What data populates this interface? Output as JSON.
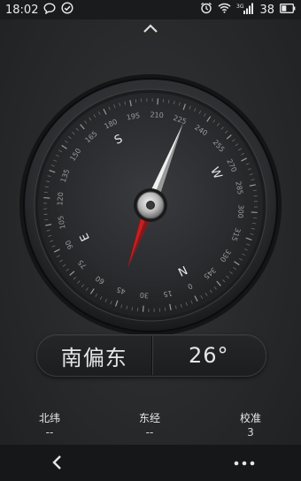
{
  "status_bar": {
    "time": "18:02",
    "signal_label": "3G",
    "battery": "38",
    "icons": [
      "chat-bubble-icon",
      "check-circle-icon",
      "alarm-icon",
      "wifi-icon",
      "signal-icon",
      "battery-icon"
    ]
  },
  "compass": {
    "heading_degrees": 26,
    "tick_labels": [
      "0",
      "15",
      "30",
      "45",
      "60",
      "75",
      "90",
      "105",
      "120",
      "135",
      "150",
      "165",
      "180",
      "195",
      "210",
      "225",
      "240",
      "255",
      "270",
      "285",
      "300",
      "315",
      "330",
      "345"
    ],
    "cardinals": [
      "N",
      "E",
      "S",
      "W"
    ],
    "needle_colors": {
      "north": "#c81e22",
      "south": "#d9d9d9"
    }
  },
  "direction": {
    "name": "南偏东",
    "angle": "26°"
  },
  "info": {
    "latitude_label": "北纬",
    "latitude_value": "--",
    "longitude_label": "东经",
    "longitude_value": "--",
    "calibration_label": "校准",
    "calibration_value": "3"
  },
  "colors": {
    "background": "#2a2b2d",
    "navbar": "#161718",
    "needle_red": "#c81e22"
  }
}
